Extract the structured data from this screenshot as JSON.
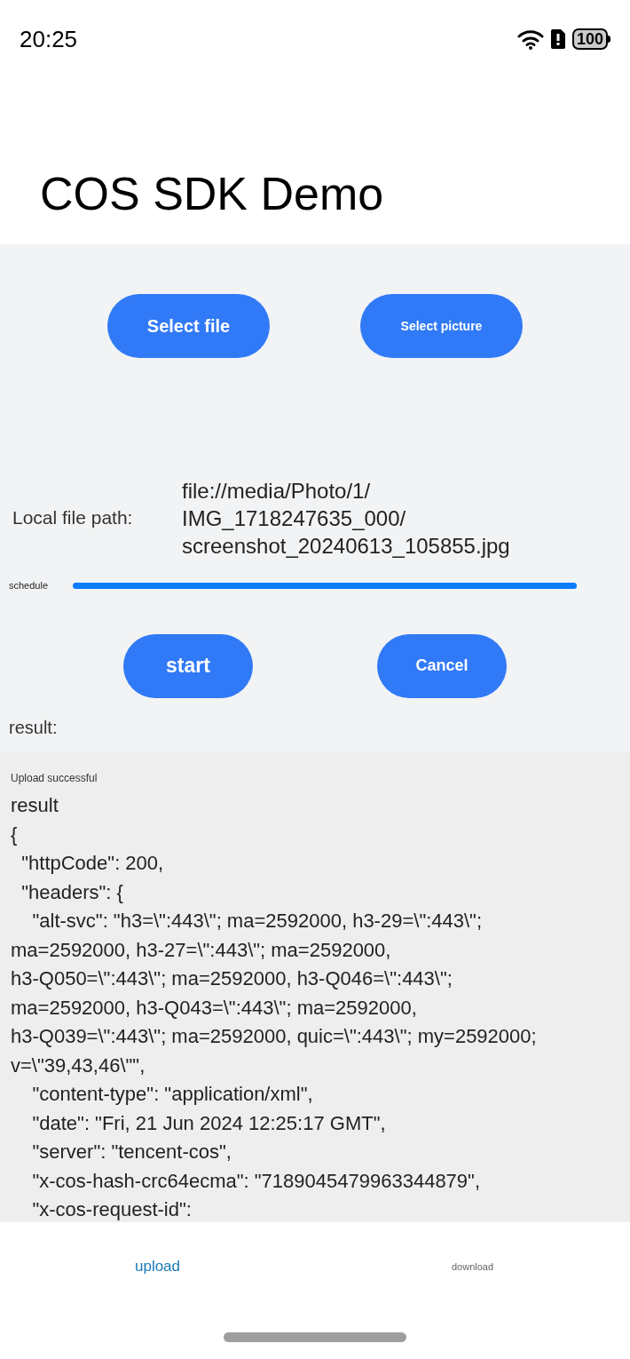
{
  "status_bar": {
    "time": "20:25",
    "battery": "100"
  },
  "title": "COS SDK Demo",
  "select_buttons": [
    "Select file",
    "Select picture"
  ],
  "local_file": {
    "label": "Local file path:",
    "path_lines": [
      "file://media/Photo/1/",
      "IMG_1718247635_000/",
      "screenshot_20240613_105855.jpg"
    ]
  },
  "progress": {
    "label": "schedule",
    "level": 1
  },
  "action_buttons": [
    "start",
    "Cancel"
  ],
  "result_label": "result:",
  "result_panel": {
    "status": "Upload successful",
    "lines": [
      "result",
      "{",
      "  \"httpCode\": 200,",
      "  \"headers\": {",
      "    \"alt-svc\": \"h3=\\\":443\\\"; ma=2592000, h3-29=\\\":443\\\";",
      "ma=2592000, h3-27=\\\":443\\\"; ma=2592000,",
      "h3-Q050=\\\":443\\\"; ma=2592000, h3-Q046=\\\":443\\\";",
      "ma=2592000, h3-Q043=\\\":443\\\"; ma=2592000,",
      "h3-Q039=\\\":443\\\"; ma=2592000, quic=\\\":443\\\"; my=2592000;",
      "v=\\\"39,43,46\\\"\",",
      "    \"content-type\": \"application/xml\",",
      "    \"date\": \"Fri, 21 Jun 2024 12:25:17 GMT\",",
      "    \"server\": \"tencent-cos\",",
      "    \"x-cos-hash-crc64ecma\": \"7189045479963344879\",",
      "    \"x-cos-request-id\":"
    ]
  },
  "tabs": [
    {
      "label": "upload",
      "selected": true
    },
    {
      "label": "download",
      "selected": false
    }
  ]
}
